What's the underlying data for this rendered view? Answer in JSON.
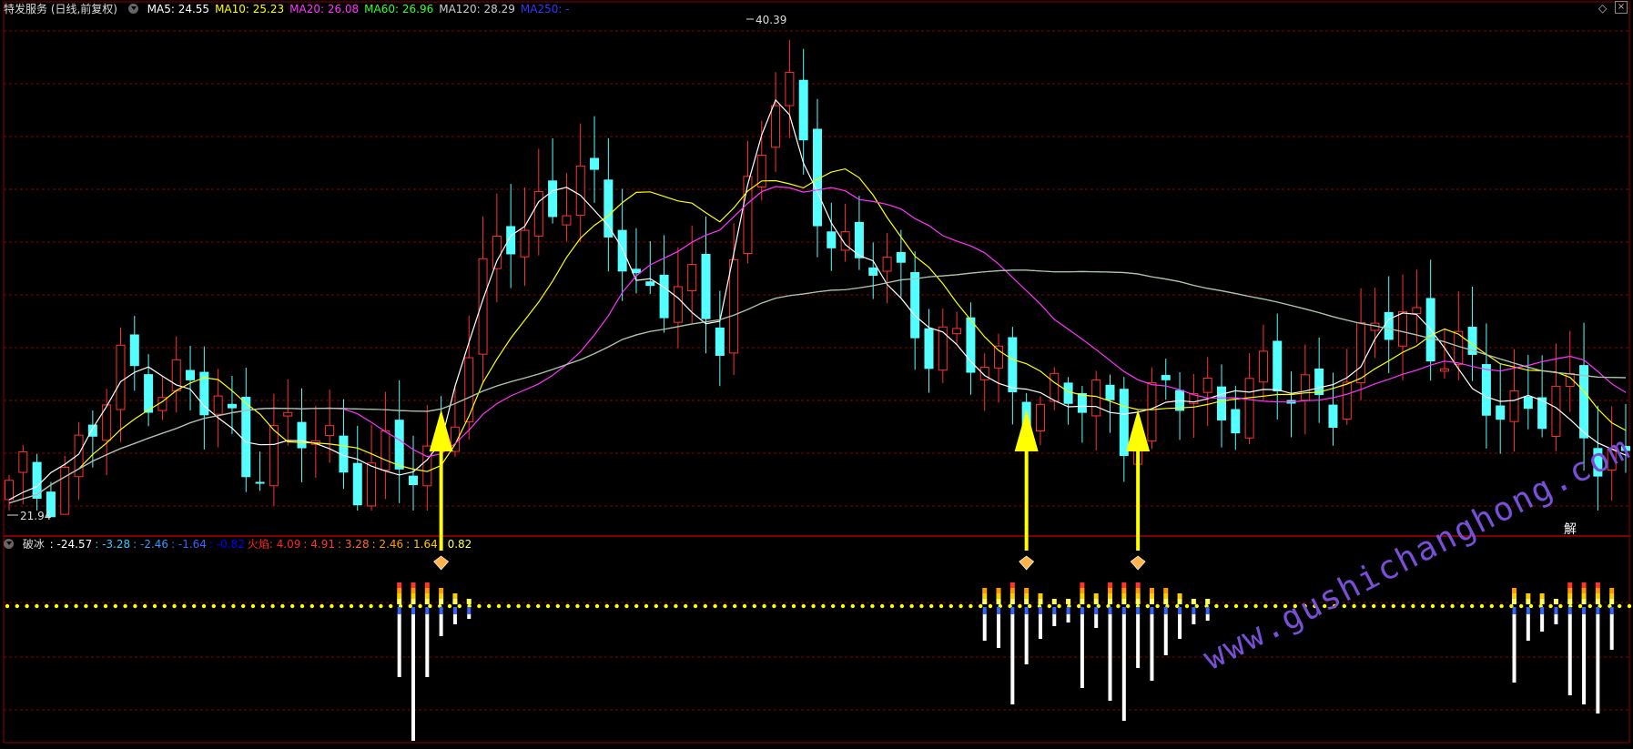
{
  "header": {
    "title": "特发服务 (日线,前复权)",
    "ma": [
      {
        "label": "MA5: 24.55",
        "color": "#ffffff"
      },
      {
        "label": "MA10: 25.23",
        "color": "#ffff00"
      },
      {
        "label": "MA20: 26.08",
        "color": "#ff33ff"
      },
      {
        "label": "MA60: 26.96",
        "color": "#33ff33"
      },
      {
        "label": "MA120: 28.29",
        "color": "#cccccc"
      },
      {
        "label": "MA250: -",
        "color": "#3333ff"
      }
    ]
  },
  "indicator_header": {
    "name": "破冰",
    "items": [
      {
        "label": ": -24.57",
        "color": "#ffffff"
      },
      {
        "label": ": -3.28",
        "color": "#33ccff"
      },
      {
        "label": ": -2.46",
        "color": "#3399ff"
      },
      {
        "label": ": -1.64",
        "color": "#3366ff"
      },
      {
        "label": ": -0.82",
        "color": "#0000ff"
      },
      {
        "label": "火焰: 4.09",
        "color": "#ff2222"
      },
      {
        "label": ": 4.91",
        "color": "#ff3333"
      },
      {
        "label": ": 3.28",
        "color": "#ff6633"
      },
      {
        "label": ": 2.46",
        "color": "#ff9900"
      },
      {
        "label": ": 1.64",
        "color": "#ffcc00"
      },
      {
        "label": ": 0.82",
        "color": "#ffff66"
      }
    ]
  },
  "buttons": {
    "jie": "解"
  },
  "watermark": "www.gushichanghong.com",
  "colors": {
    "up": "#ff3232",
    "down": "#54ffff",
    "grid": "#8b0000",
    "arrow": "#ffff00"
  },
  "chart_data": {
    "type": "candlestick",
    "price_labels": {
      "high": "40.39",
      "low": "21.94"
    },
    "high_value": 40.39,
    "low_value": 21.94,
    "arrow_bar_indices": [
      31,
      73,
      81
    ],
    "series": [
      {
        "name": "MA5",
        "values": [
          22.35,
          22.62,
          22.84,
          23.36,
          23.67,
          24.05,
          25.02,
          25.84,
          26.76,
          27.11,
          27.31,
          26.97,
          26.64,
          26.48,
          25.85,
          25.41,
          25.02,
          24.5,
          24.4,
          24.41,
          24.56,
          24.55,
          24.45,
          24.25,
          24.0,
          23.86,
          23.6,
          23.42,
          23.27,
          23.39,
          23.84,
          24.51,
          26.59,
          28.23,
          29.84,
          31.28,
          32.22,
          32.57,
          33.49,
          33.9,
          34.03,
          33.73,
          33.17,
          32.59,
          31.74,
          30.55,
          30.61,
          30.29,
          29.89,
          29.35,
          28.93,
          29.02,
          31.55,
          34.13,
          35.99,
          37.3,
          36.74,
          34.93,
          33.86,
          32.7,
          31.89,
          31.48,
          31.28,
          30.4,
          29.88,
          29.23,
          28.79,
          28.62,
          28.15,
          27.52,
          26.99,
          26.7,
          26.53,
          26.48,
          26.35,
          26.06,
          25.82,
          25.84,
          25.83,
          25.61,
          25.55,
          25.62,
          25.75,
          25.99,
          26.05,
          26.0,
          26.12,
          26.29,
          26.42,
          26.37,
          26.47,
          26.46,
          26.32,
          26.41,
          26.54,
          26.65,
          26.91,
          27.32,
          28.35,
          29.09,
          29.33,
          29.28,
          28.71,
          28.02,
          27.24,
          26.5,
          26.19,
          26.02,
          26.06,
          26.25,
          26.06,
          25.79,
          25.35,
          24.86,
          24.47,
          24.24,
          24.01
        ]
      },
      {
        "name": "MA10",
        "values": [
          22.22,
          22.38,
          22.54,
          22.9,
          23.2,
          23.5,
          24.04,
          24.47,
          24.97,
          25.36,
          25.7,
          26.01,
          26.43,
          26.71,
          26.91,
          26.84,
          26.42,
          25.95,
          25.55,
          24.95,
          24.51,
          24.49,
          24.47,
          24.43,
          24.36,
          24.28,
          24.06,
          23.83,
          23.62,
          23.49,
          23.4,
          23.63,
          24.41,
          25.47,
          26.73,
          27.6,
          28.39,
          29.06,
          29.74,
          30.52,
          31.41,
          32.13,
          32.61,
          32.97,
          33.46,
          33.84,
          33.86,
          33.69,
          33.52,
          33.44,
          33.08,
          32.74,
          33.26,
          33.89,
          34.27,
          34.28,
          34.16,
          34.01,
          34.33,
          34.6,
          34.72,
          34.39,
          33.74,
          32.9,
          32.17,
          31.45,
          31.04,
          30.43,
          29.71,
          29.07,
          28.44,
          27.93,
          27.59,
          27.43,
          27.15,
          26.73,
          26.39,
          26.26,
          26.21,
          26.03,
          25.84,
          25.72,
          25.71,
          25.76,
          25.78,
          25.81,
          25.91,
          26.04,
          26.11,
          26.16,
          26.22,
          26.28,
          26.28,
          26.34,
          26.37,
          26.51,
          26.67,
          26.89,
          27.24,
          27.54,
          27.86,
          28.1,
          28.49,
          28.73,
          28.54,
          28.15,
          27.78,
          27.43,
          27.31,
          27.19,
          27.17,
          27.12,
          26.92,
          26.41,
          25.74,
          25.22,
          24.94
        ]
      },
      {
        "name": "MA20",
        "values": [
          22.22,
          22.38,
          22.54,
          22.9,
          23.2,
          23.5,
          23.79,
          24.03,
          24.26,
          24.45,
          24.65,
          24.83,
          25.01,
          25.22,
          25.39,
          25.49,
          25.6,
          25.68,
          25.75,
          25.77,
          25.76,
          25.75,
          25.76,
          25.77,
          25.74,
          25.56,
          25.24,
          24.89,
          24.58,
          24.22,
          23.96,
          24.06,
          24.44,
          24.95,
          25.54,
          25.94,
          26.23,
          26.45,
          26.68,
          27.0,
          27.4,
          27.88,
          28.51,
          29.22,
          30.1,
          30.72,
          31.13,
          31.38,
          31.63,
          31.98,
          32.24,
          32.43,
          32.93,
          33.43,
          33.87,
          34.06,
          34.01,
          33.85,
          33.93,
          34.02,
          33.9,
          33.57,
          33.5,
          33.39,
          33.22,
          32.86,
          32.6,
          32.22,
          32.02,
          31.84,
          31.58,
          31.16,
          30.66,
          30.16,
          29.66,
          29.09,
          28.72,
          28.35,
          27.96,
          27.55,
          27.14,
          26.83,
          26.65,
          26.6,
          26.46,
          26.27,
          26.15,
          26.15,
          26.16,
          26.09,
          26.03,
          26.0,
          26.0,
          26.05,
          26.07,
          26.16,
          26.29,
          26.47,
          26.68,
          26.85,
          27.04,
          27.19,
          27.38,
          27.53,
          27.46,
          27.33,
          27.22,
          27.16,
          27.27,
          27.37,
          27.51,
          27.61,
          27.71,
          27.57,
          27.14,
          26.68,
          26.36
        ]
      },
      {
        "name": "MA60",
        "values": [
          22.22,
          22.38,
          22.54,
          22.9,
          23.2,
          23.5,
          23.79,
          24.03,
          24.26,
          24.45,
          24.65,
          24.83,
          25.01,
          25.22,
          25.39,
          25.49,
          25.6,
          25.68,
          25.75,
          25.77,
          25.76,
          25.75,
          25.76,
          25.77,
          25.76,
          25.74,
          25.73,
          25.71,
          25.68,
          25.66,
          25.65,
          25.74,
          25.94,
          26.17,
          26.41,
          26.6,
          26.76,
          26.9,
          27.05,
          27.22,
          27.4,
          27.58,
          27.81,
          28.06,
          28.34,
          28.51,
          28.64,
          28.72,
          28.82,
          28.92,
          29.0,
          29.08,
          29.25,
          29.46,
          29.7,
          29.88,
          29.98,
          30.04,
          30.12,
          30.18,
          30.2,
          30.27,
          30.35,
          30.46,
          30.57,
          30.61,
          30.68,
          30.72,
          30.76,
          30.82,
          30.87,
          30.91,
          30.93,
          30.93,
          30.9,
          30.87,
          30.87,
          30.88,
          30.87,
          30.86,
          30.84,
          30.79,
          30.68,
          30.6,
          30.5,
          30.36,
          30.25,
          30.16,
          30.06,
          29.95,
          29.85,
          29.74,
          29.61,
          29.48,
          29.34,
          29.19,
          29.06,
          28.94,
          28.85,
          28.74,
          28.63,
          28.51,
          28.38,
          28.25,
          28.08,
          27.93,
          27.77,
          27.61,
          27.45,
          27.3,
          27.17,
          27.1,
          27.05,
          26.99,
          26.93,
          26.92,
          26.91
        ]
      },
      {
        "name": "MA120",
        "values": [
          22.22,
          22.38,
          22.54,
          22.9,
          23.2,
          23.5,
          23.79,
          24.03,
          24.26,
          24.45,
          24.65,
          24.83,
          25.01,
          25.22,
          25.39,
          25.49,
          25.6,
          25.68,
          25.75,
          25.77,
          25.76,
          25.75,
          25.76,
          25.77,
          25.76,
          25.74,
          25.73,
          25.71,
          25.68,
          25.66,
          25.65,
          25.74,
          25.94,
          26.17,
          26.41,
          26.6,
          26.76,
          26.9,
          27.05,
          27.22,
          27.4,
          27.58,
          27.81,
          28.06,
          28.34,
          28.51,
          28.64,
          28.72,
          28.82,
          28.92,
          29.0,
          29.08,
          29.25,
          29.46,
          29.7,
          29.88,
          29.98,
          30.04,
          30.12,
          30.18,
          30.2,
          30.27,
          30.35,
          30.46,
          30.57,
          30.61,
          30.68,
          30.72,
          30.76,
          30.82,
          30.87,
          30.91,
          30.93,
          30.93,
          30.9,
          30.87,
          30.87,
          30.88,
          30.87,
          30.86,
          30.84,
          30.79,
          30.68,
          30.6,
          30.5,
          30.36,
          30.25,
          30.16,
          30.06,
          29.95,
          29.85,
          29.74,
          29.61,
          29.48,
          29.34,
          29.19,
          29.06,
          28.94,
          28.85,
          28.74,
          28.63,
          28.51,
          28.38,
          28.25,
          28.08,
          27.93,
          27.77,
          27.61,
          27.45,
          27.3,
          27.17,
          27.1,
          27.05,
          26.99,
          26.93,
          26.92,
          26.91
        ]
      }
    ]
  }
}
